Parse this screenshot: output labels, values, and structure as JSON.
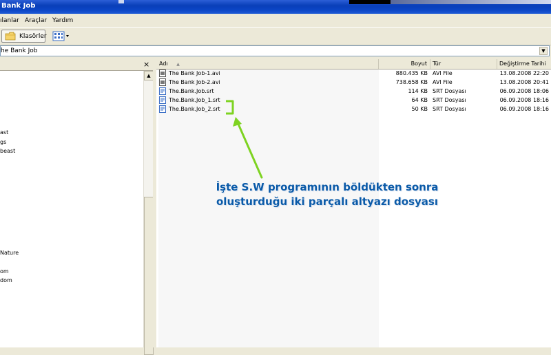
{
  "window": {
    "title": "Bank Job"
  },
  "menu": [
    "ılanlar",
    "Araçlar",
    "Yardım"
  ],
  "toolbar": {
    "folders_label": "Klasörler",
    "view_icon": "views-icon"
  },
  "address": {
    "value": "he Bank Job"
  },
  "left_pane": {
    "close_glyph": "×",
    "tree_items": [
      "ast",
      "gs",
      "beast",
      "Nature",
      "om",
      "dom"
    ]
  },
  "file_list": {
    "columns": [
      "Adı",
      "Boyut",
      "Tür",
      "Değiştirme Tarihi"
    ],
    "sort_indicator": "▲",
    "rows": [
      {
        "name": "The Bank Job-1.avi",
        "size": "880.435 KB",
        "type": "AVI File",
        "modified": "13.08.2008 22:20",
        "icon": "avi-file-icon"
      },
      {
        "name": "The Bank Job-2.avi",
        "size": "738.658 KB",
        "type": "AVI File",
        "modified": "13.08.2008 20:41",
        "icon": "avi-file-icon"
      },
      {
        "name": "The.Bank.Job.srt",
        "size": "114 KB",
        "type": "SRT Dosyası",
        "modified": "06.09.2008 18:06",
        "icon": "srt-file-icon"
      },
      {
        "name": "The.Bank.Job_1.srt",
        "size": "64 KB",
        "type": "SRT Dosyası",
        "modified": "06.09.2008 18:16",
        "icon": "srt-file-icon"
      },
      {
        "name": "The.Bank.Job_2.srt",
        "size": "50 KB",
        "type": "SRT Dosyası",
        "modified": "06.09.2008 18:16",
        "icon": "srt-file-icon"
      }
    ]
  },
  "annotation": {
    "line1": "İşte S.W programının böldükten sonra",
    "line2": "oluşturduğu iki parçalı altyazı dosyası",
    "arrow_color": "#7ed321",
    "text_color": "#0a5aa8"
  }
}
